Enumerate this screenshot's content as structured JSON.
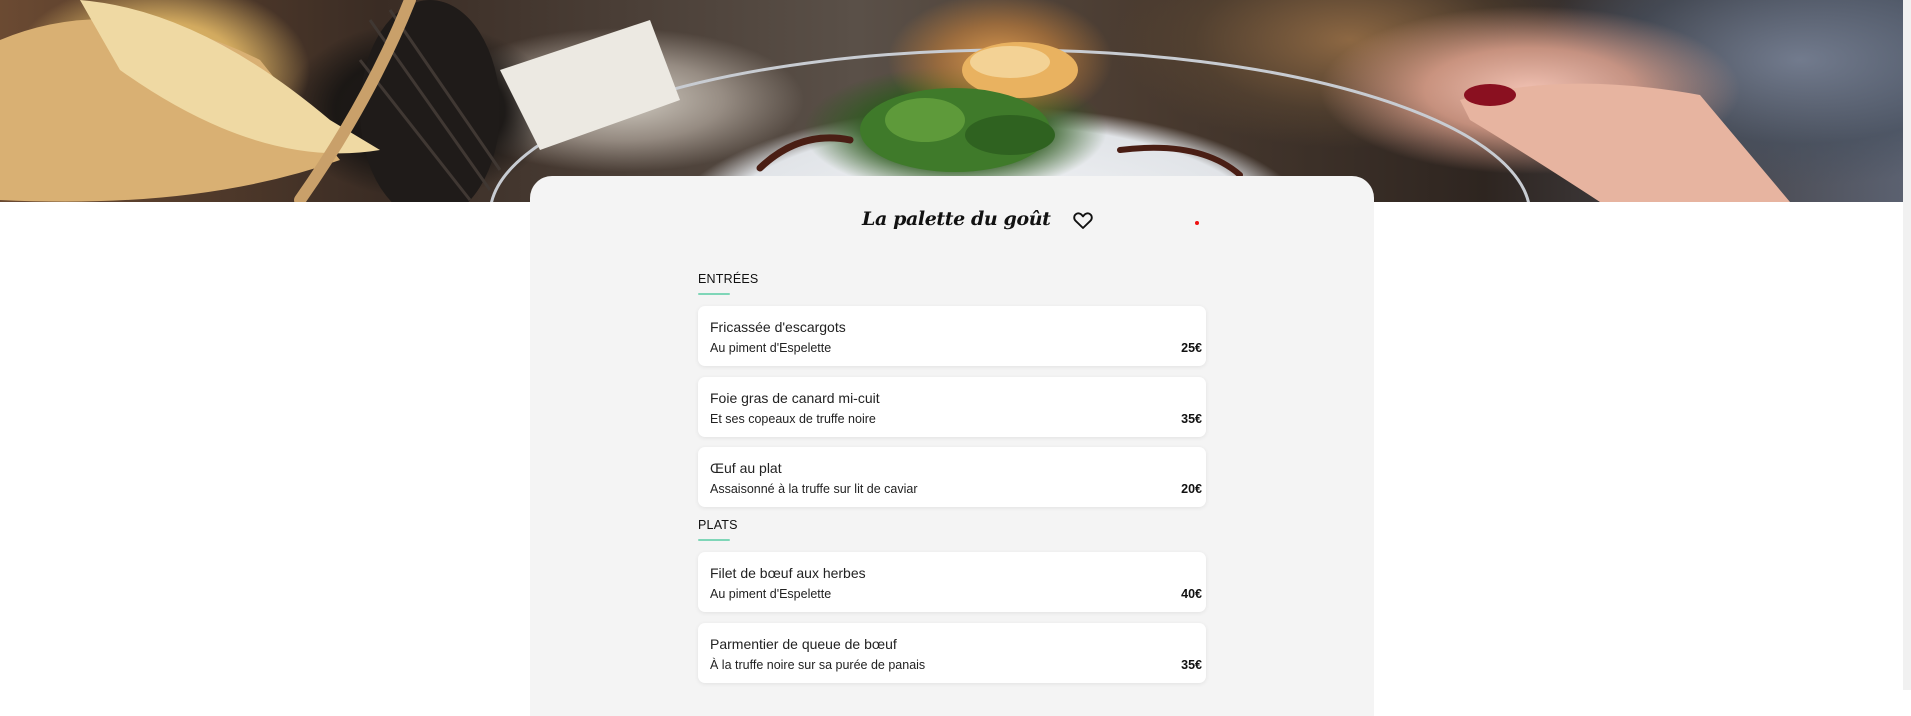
{
  "restaurant": {
    "name": "La palette du goût"
  },
  "colors": {
    "accent_underline": "#7fd6b8",
    "card_bg": "#f4f4f4",
    "notification_dot": "#e11111"
  },
  "icons": {
    "favorite": "heart-outline-icon"
  },
  "sections": [
    {
      "title": "ENTRÉES",
      "items": [
        {
          "name": "Fricassée d'escargots",
          "description": "Au piment d'Espelette",
          "price": "25€"
        },
        {
          "name": "Foie gras de canard mi-cuit",
          "description": "Et ses copeaux de truffe noire",
          "price": "35€"
        },
        {
          "name": "Œuf au plat",
          "description": "Assaisonné à la truffe sur lit de caviar",
          "price": "20€"
        }
      ]
    },
    {
      "title": "PLATS",
      "items": [
        {
          "name": "Filet de bœuf aux herbes",
          "description": "Au piment d'Espelette",
          "price": "40€"
        },
        {
          "name": "Parmentier de queue de bœuf",
          "description": "À la truffe noire sur sa purée de panais",
          "price": "35€"
        }
      ]
    }
  ]
}
